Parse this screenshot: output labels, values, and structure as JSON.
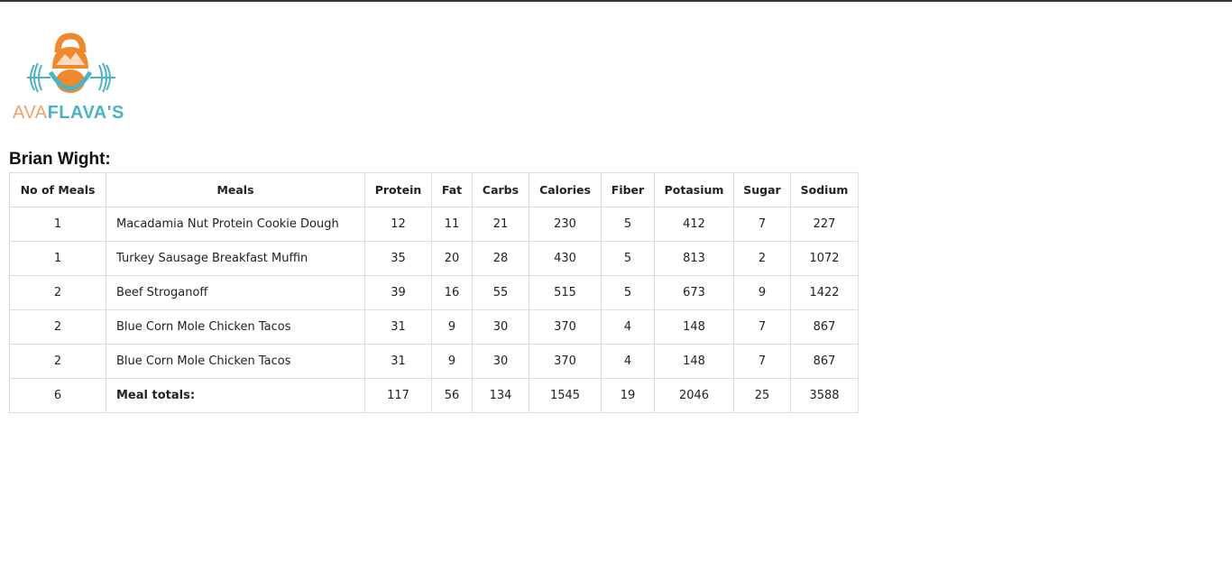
{
  "brand": {
    "logo_text_left": "AVA",
    "logo_text_right": "FLAVA'S",
    "colors": {
      "orange": "#f0892e",
      "teal": "#4bb3c4"
    }
  },
  "customer_heading": "Brian Wight:",
  "table": {
    "headers": [
      "No of Meals",
      "Meals",
      "Protein",
      "Fat",
      "Carbs",
      "Calories",
      "Fiber",
      "Potasium",
      "Sugar",
      "Sodium"
    ],
    "rows": [
      [
        "1",
        "Macadamia Nut Protein Cookie Dough",
        "12",
        "11",
        "21",
        "230",
        "5",
        "412",
        "7",
        "227"
      ],
      [
        "1",
        "Turkey Sausage Breakfast Muffin",
        "35",
        "20",
        "28",
        "430",
        "5",
        "813",
        "2",
        "1072"
      ],
      [
        "2",
        "Beef Stroganoff",
        "39",
        "16",
        "55",
        "515",
        "5",
        "673",
        "9",
        "1422"
      ],
      [
        "2",
        "Blue Corn Mole Chicken Tacos",
        "31",
        "9",
        "30",
        "370",
        "4",
        "148",
        "7",
        "867"
      ],
      [
        "2",
        "Blue Corn Mole Chicken Tacos",
        "31",
        "9",
        "30",
        "370",
        "4",
        "148",
        "7",
        "867"
      ]
    ],
    "totals": [
      "6",
      "Meal totals:",
      "117",
      "56",
      "134",
      "1545",
      "19",
      "2046",
      "25",
      "3588"
    ]
  }
}
